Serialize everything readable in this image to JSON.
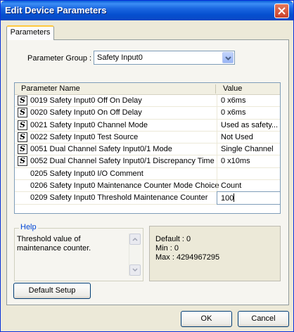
{
  "window": {
    "title": "Edit Device Parameters"
  },
  "tabs": [
    {
      "label": "Parameters"
    }
  ],
  "parameter_group": {
    "label": "Parameter Group :",
    "value": "Safety Input0"
  },
  "grid": {
    "columns": [
      "Parameter Name",
      "Value"
    ],
    "rows": [
      {
        "icon": "safety-s-icon",
        "badge": "S",
        "name": "0019 Safety Input0 Off On Delay",
        "value": "0 x6ms"
      },
      {
        "icon": "safety-s-icon",
        "badge": "S",
        "name": "0020 Safety Input0 On Off Delay",
        "value": "0 x6ms"
      },
      {
        "icon": "safety-s-icon",
        "badge": "S",
        "name": "0021 Safety Input0 Channel Mode",
        "value": "Used as safety..."
      },
      {
        "icon": "safety-s-icon",
        "badge": "S",
        "name": "0022 Safety Input0 Test Source",
        "value": "Not Used"
      },
      {
        "icon": "safety-s-icon",
        "badge": "S",
        "name": "0051 Dual Channel Safety Input0/1 Mode",
        "value": "Single Channel"
      },
      {
        "icon": "safety-s-icon",
        "badge": "S",
        "name": "0052 Dual Channel Safety Input0/1 Discrepancy Time",
        "value": "0 x10ms"
      },
      {
        "icon": "",
        "badge": "",
        "name": "0205 Safety Input0 I/O Comment",
        "value": ""
      },
      {
        "icon": "",
        "badge": "",
        "name": "0206 Safety Input0 Maintenance Counter Mode Choice",
        "value": "Count"
      },
      {
        "icon": "",
        "badge": "",
        "name": "0209 Safety Input0 Threshold Maintenance Counter",
        "value": "100",
        "editing": true
      }
    ]
  },
  "help": {
    "legend": "Help",
    "text": "Threshold value of maintenance counter."
  },
  "info": {
    "default": "Default : 0",
    "min": "Min : 0",
    "max": "Max : 4294967295"
  },
  "buttons": {
    "default_setup": "Default Setup",
    "ok": "OK",
    "cancel": "Cancel"
  },
  "colors": {
    "title_bar": "#0a5fd8",
    "dialog_bg": "#ece9d8",
    "help_legend": "#0046d5",
    "tab_highlight": "#ffc83c"
  }
}
